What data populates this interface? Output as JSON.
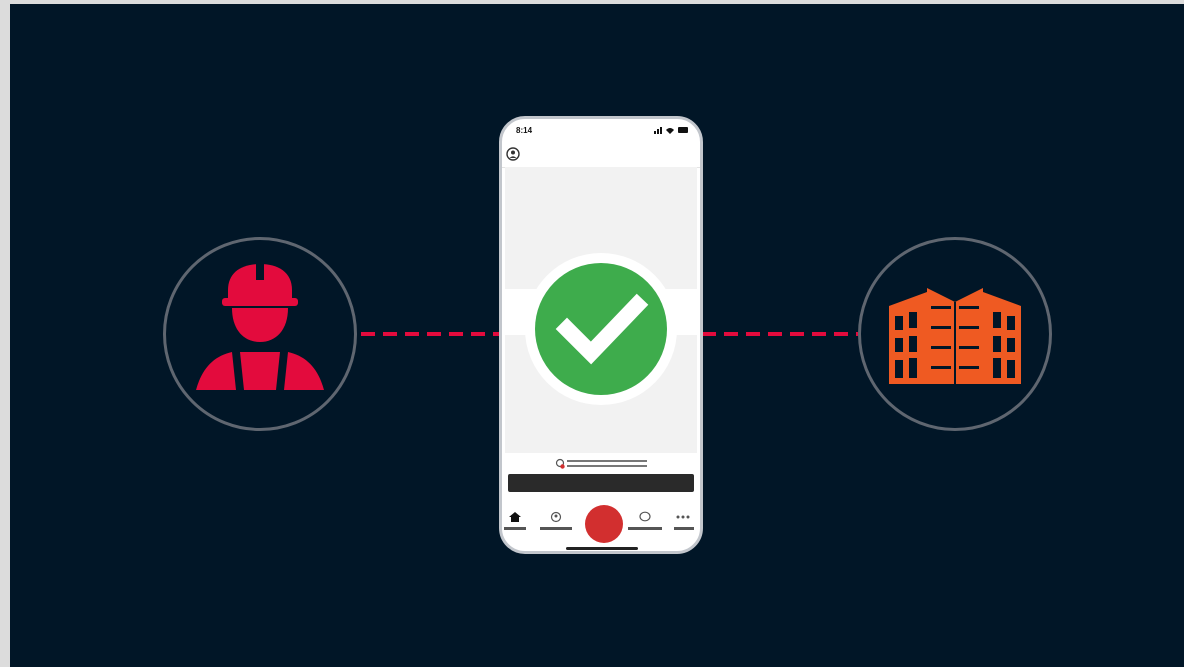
{
  "colors": {
    "background": "#011627",
    "accent_red": "#e30b3d",
    "accent_orange": "#ef5a22",
    "success_green": "#3eac4c",
    "record_red": "#d22f2f",
    "circle_border": "#5f6670"
  },
  "phone": {
    "status_time": "8:14",
    "icons": {
      "profile": "profile-icon",
      "location": "location-pin-icon",
      "home": "home-icon",
      "map": "map-pin-icon",
      "chat": "chat-bubble-icon",
      "more": "more-dots-icon"
    }
  },
  "illustration": {
    "left_icon": "construction-worker-icon",
    "center_icon": "checkmark-icon",
    "right_icon": "building-icon"
  }
}
